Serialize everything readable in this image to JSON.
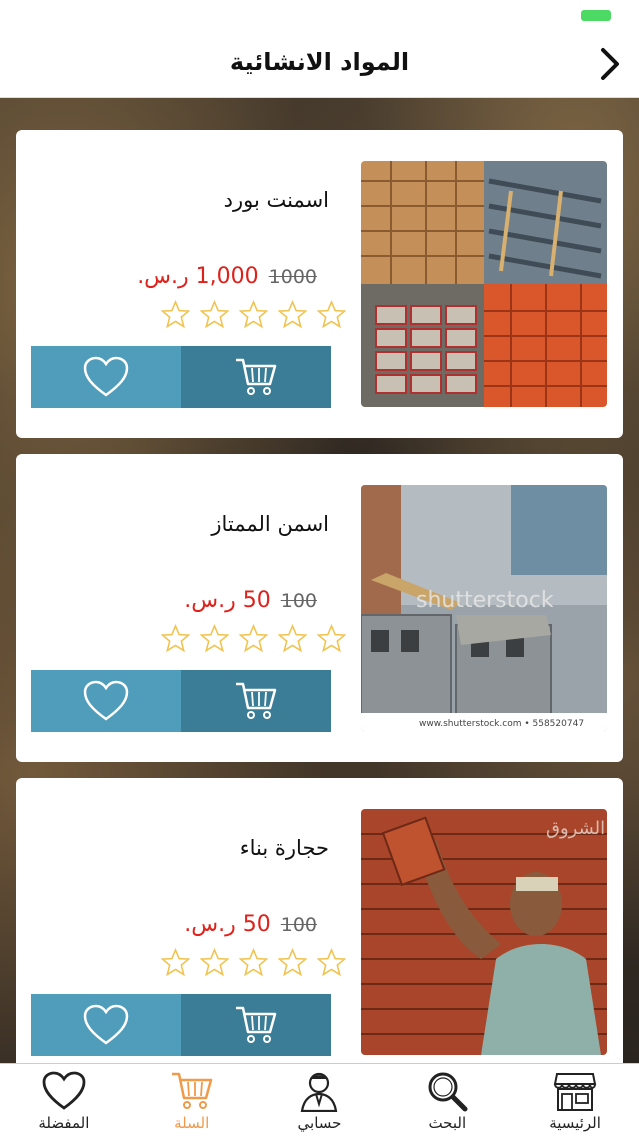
{
  "header": {
    "title": "المواد الانشائية"
  },
  "products": [
    {
      "name": "اسمنت بورد",
      "price": "1,000 ر.س.",
      "old_price": "1000",
      "image_label": ""
    },
    {
      "name": "اسمن الممتاز",
      "price": "50 ر.س.",
      "old_price": "100",
      "image_label": "shutterstock",
      "image_caption": "www.shutterstock.com • 558520747"
    },
    {
      "name": "حجارة بناء",
      "price": "50 ر.س.",
      "old_price": "100",
      "image_label": "الشروق"
    }
  ],
  "colors": {
    "accent": "#f09a4a",
    "fav_button": "#4f9cbb",
    "cart_button": "#3b7d97",
    "price": "#e0201a",
    "star": "#f1c24e"
  },
  "tabs": [
    {
      "label": "المفضلة",
      "icon": "heart-icon"
    },
    {
      "label": "السلة",
      "icon": "cart-icon",
      "active": true
    },
    {
      "label": "حسابي",
      "icon": "user-icon"
    },
    {
      "label": "البحث",
      "icon": "search-icon"
    },
    {
      "label": "الرئيسية",
      "icon": "store-icon"
    }
  ]
}
